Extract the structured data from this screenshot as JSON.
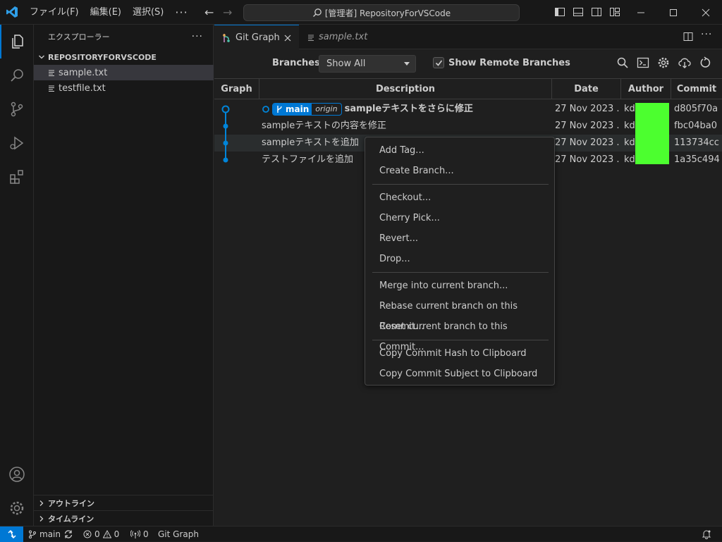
{
  "titlebar": {
    "menu": [
      "ファイル(F)",
      "編集(E)",
      "選択(S)"
    ],
    "more": "···",
    "search": "[管理者] RepositoryForVSCode",
    "back": "←",
    "forward": "→"
  },
  "sidebar": {
    "title": "エクスプローラー",
    "more": "···",
    "repo": "REPOSITORYFORVSCODE",
    "files": [
      "sample.txt",
      "testfile.txt"
    ],
    "outline": "アウトライン",
    "timeline": "タイムライン"
  },
  "tabs": {
    "active": "Git Graph",
    "inactive": "sample.txt"
  },
  "toolbar": {
    "branches_label": "Branches:",
    "branches_value": "Show All",
    "remote_label": "Show Remote Branches"
  },
  "table": {
    "headers": {
      "graph": "Graph",
      "description": "Description",
      "date": "Date",
      "author": "Author",
      "commit": "Commit"
    },
    "badge": {
      "branch": "main",
      "remote": "origin"
    },
    "rows": [
      {
        "description": "sampleテキストをさらに修正",
        "date": "27 Nov 2023 ...",
        "author": "kd",
        "commit": "d805f70a"
      },
      {
        "description": "sampleテキストの内容を修正",
        "date": "27 Nov 2023 ...",
        "author": "kd",
        "commit": "fbc04ba0"
      },
      {
        "description": "sampleテキストを追加",
        "date": "27 Nov 2023 ...",
        "author": "kd",
        "commit": "113734cc"
      },
      {
        "description": "テストファイルを追加",
        "date": "27 Nov 2023 ...",
        "author": "kd",
        "commit": "1a35c494"
      }
    ]
  },
  "context_menu": {
    "groups": [
      [
        "Add Tag...",
        "Create Branch..."
      ],
      [
        "Checkout...",
        "Cherry Pick...",
        "Revert...",
        "Drop..."
      ],
      [
        "Merge into current branch...",
        "Rebase current branch on this Commit...",
        "Reset current branch to this Commit..."
      ],
      [
        "Copy Commit Hash to Clipboard",
        "Copy Commit Subject to Clipboard"
      ]
    ]
  },
  "statusbar": {
    "branch": "main",
    "errors": "0",
    "warnings": "0",
    "ports": "0",
    "git_graph": "Git Graph"
  },
  "colors": {
    "accent": "#0078d4",
    "graph_line": "#0085d9",
    "redaction": "#4cff2f"
  },
  "icons": [
    "vscode-logo-icon",
    "explorer-icon",
    "search-icon",
    "source-control-icon",
    "run-debug-icon",
    "extensions-icon",
    "account-icon",
    "gear-icon",
    "git-graph-icon",
    "file-icon",
    "split-editor-icon",
    "find-icon",
    "terminal-icon",
    "settings-icon",
    "fetch-icon",
    "refresh-icon",
    "bell-icon"
  ]
}
